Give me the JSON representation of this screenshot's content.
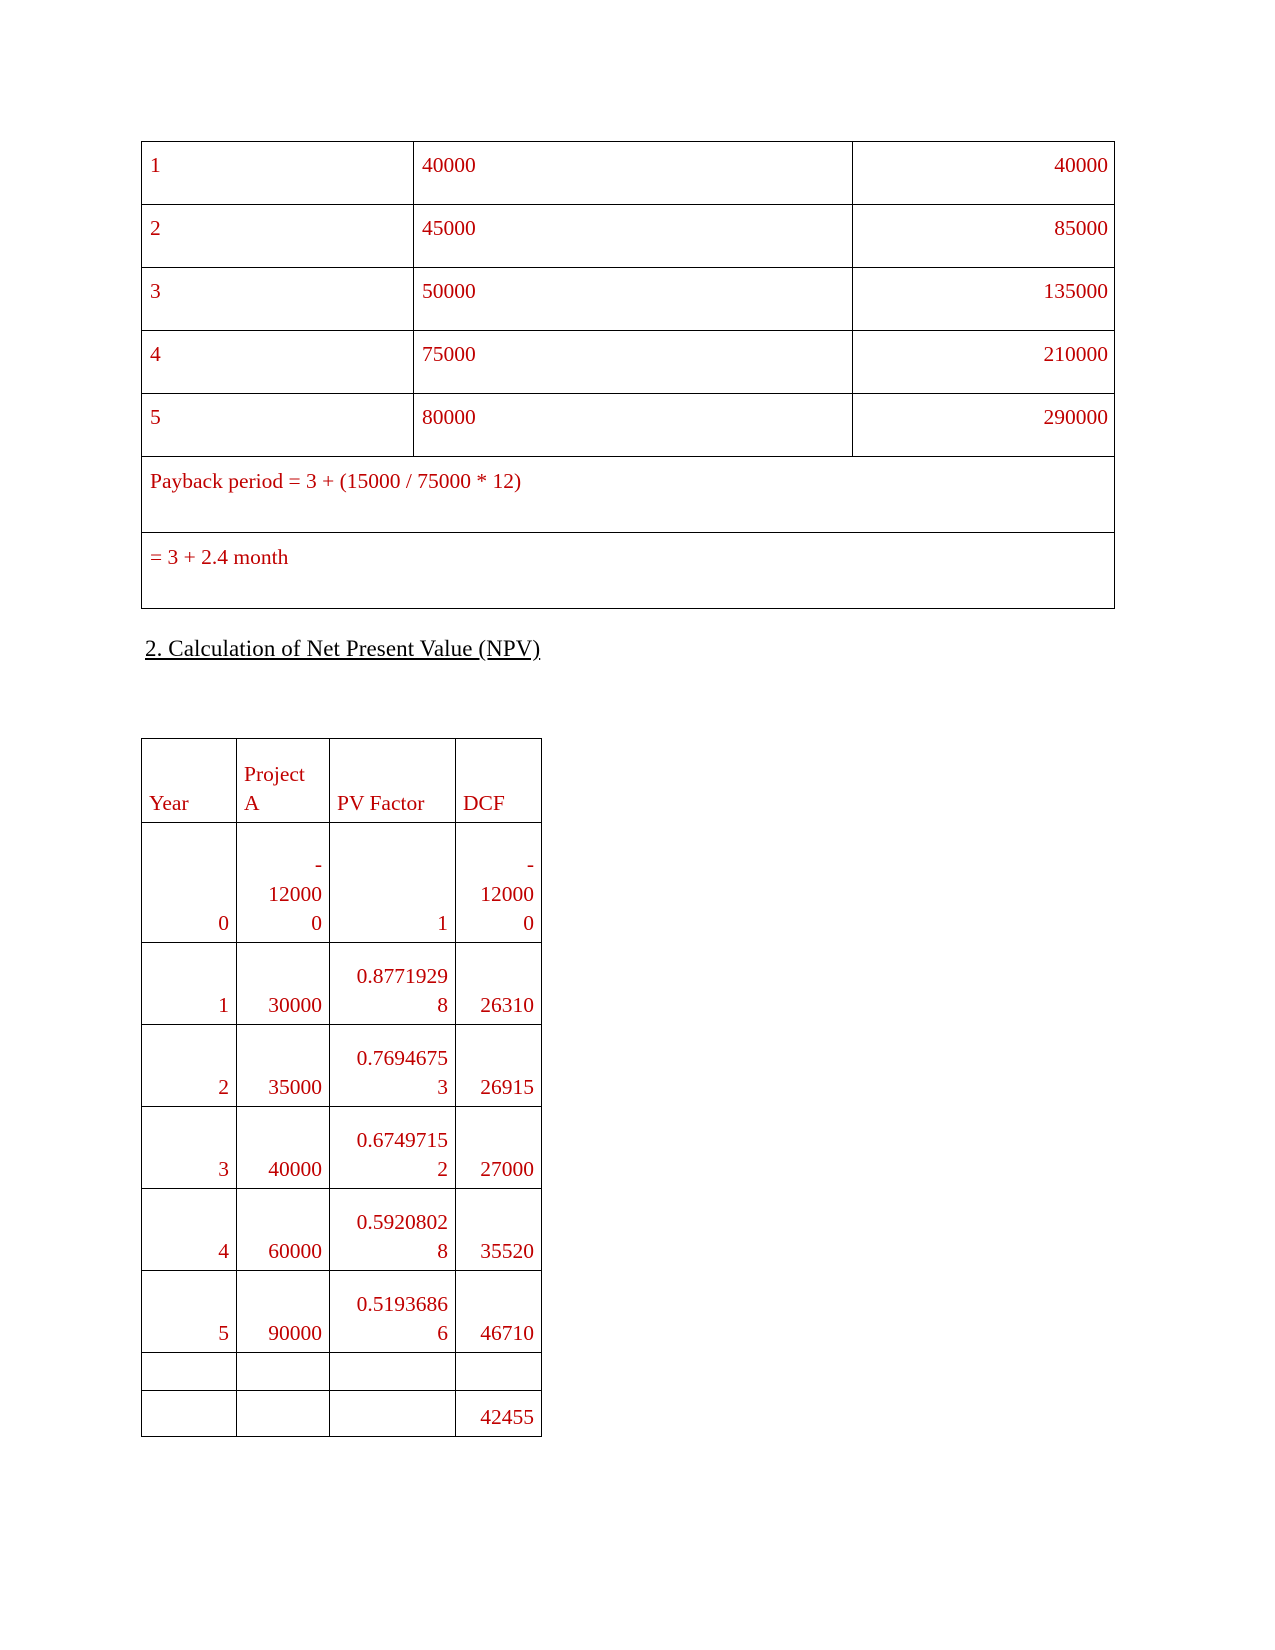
{
  "colors": {
    "text_red": "#C00000",
    "heading_black": "#000000",
    "border": "#000000",
    "background": "#FFFFFF"
  },
  "payback_table": {
    "rows": [
      {
        "year": "1",
        "cash_flow": "40000",
        "cumulative": "40000"
      },
      {
        "year": "2",
        "cash_flow": "45000",
        "cumulative": "85000"
      },
      {
        "year": "3",
        "cash_flow": "50000",
        "cumulative": "135000"
      },
      {
        "year": "4",
        "cash_flow": "75000",
        "cumulative": "210000"
      },
      {
        "year": "5",
        "cash_flow": "80000",
        "cumulative": "290000"
      }
    ],
    "footer_rows": [
      "Payback period = 3 + (15000 / 75000 * 12)",
      "= 3 + 2.4 month"
    ]
  },
  "section_heading": "2. Calculation of Net Present Value (NPV)",
  "npv_table": {
    "headers": {
      "year": "Year",
      "project": "Project A",
      "project_line1": "Project",
      "project_line2": "A",
      "pv_factor": "PV Factor",
      "dcf": "DCF"
    },
    "rows": [
      {
        "year": "0",
        "project_a_line1": "-",
        "project_a_line2": "12000",
        "project_a_line3": "0",
        "pv_factor_line1": "",
        "pv_factor_line2": "1",
        "dcf_line1": "-",
        "dcf_line2": "12000",
        "dcf_line3": "0"
      },
      {
        "year": "1",
        "project_a": "30000",
        "pv_factor_line1": "0.8771929",
        "pv_factor_line2": "8",
        "dcf": "26310"
      },
      {
        "year": "2",
        "project_a": "35000",
        "pv_factor_line1": "0.7694675",
        "pv_factor_line2": "3",
        "dcf": "26915"
      },
      {
        "year": "3",
        "project_a": "40000",
        "pv_factor_line1": "0.6749715",
        "pv_factor_line2": "2",
        "dcf": "27000"
      },
      {
        "year": "4",
        "project_a": "60000",
        "pv_factor_line1": "0.5920802",
        "pv_factor_line2": "8",
        "dcf": "35520"
      },
      {
        "year": "5",
        "project_a": "90000",
        "pv_factor_line1": "0.5193686",
        "pv_factor_line2": "6",
        "dcf": "46710"
      }
    ],
    "blank_row": {
      "year": "",
      "project_a": "",
      "pv_factor": "",
      "dcf": ""
    },
    "total_row": {
      "year": "",
      "project_a": "",
      "pv_factor": "",
      "dcf": "42455"
    }
  },
  "chart_data": {
    "type": "table",
    "title": "2. Calculation of Net Present Value (NPV)",
    "columns": [
      "Year",
      "Project A",
      "PV Factor",
      "DCF"
    ],
    "rows": [
      [
        "0",
        "-120000",
        "1",
        "-120000"
      ],
      [
        "1",
        "30000",
        "0.87719298",
        "26310"
      ],
      [
        "2",
        "35000",
        "0.76946753",
        "26915"
      ],
      [
        "3",
        "40000",
        "0.67497152",
        "27000"
      ],
      [
        "4",
        "60000",
        "0.59208028",
        "35520"
      ],
      [
        "5",
        "90000",
        "0.51936866",
        "46710"
      ],
      [
        "",
        "",
        "",
        ""
      ],
      [
        "",
        "",
        "",
        "42455"
      ]
    ],
    "npv": 42455
  }
}
